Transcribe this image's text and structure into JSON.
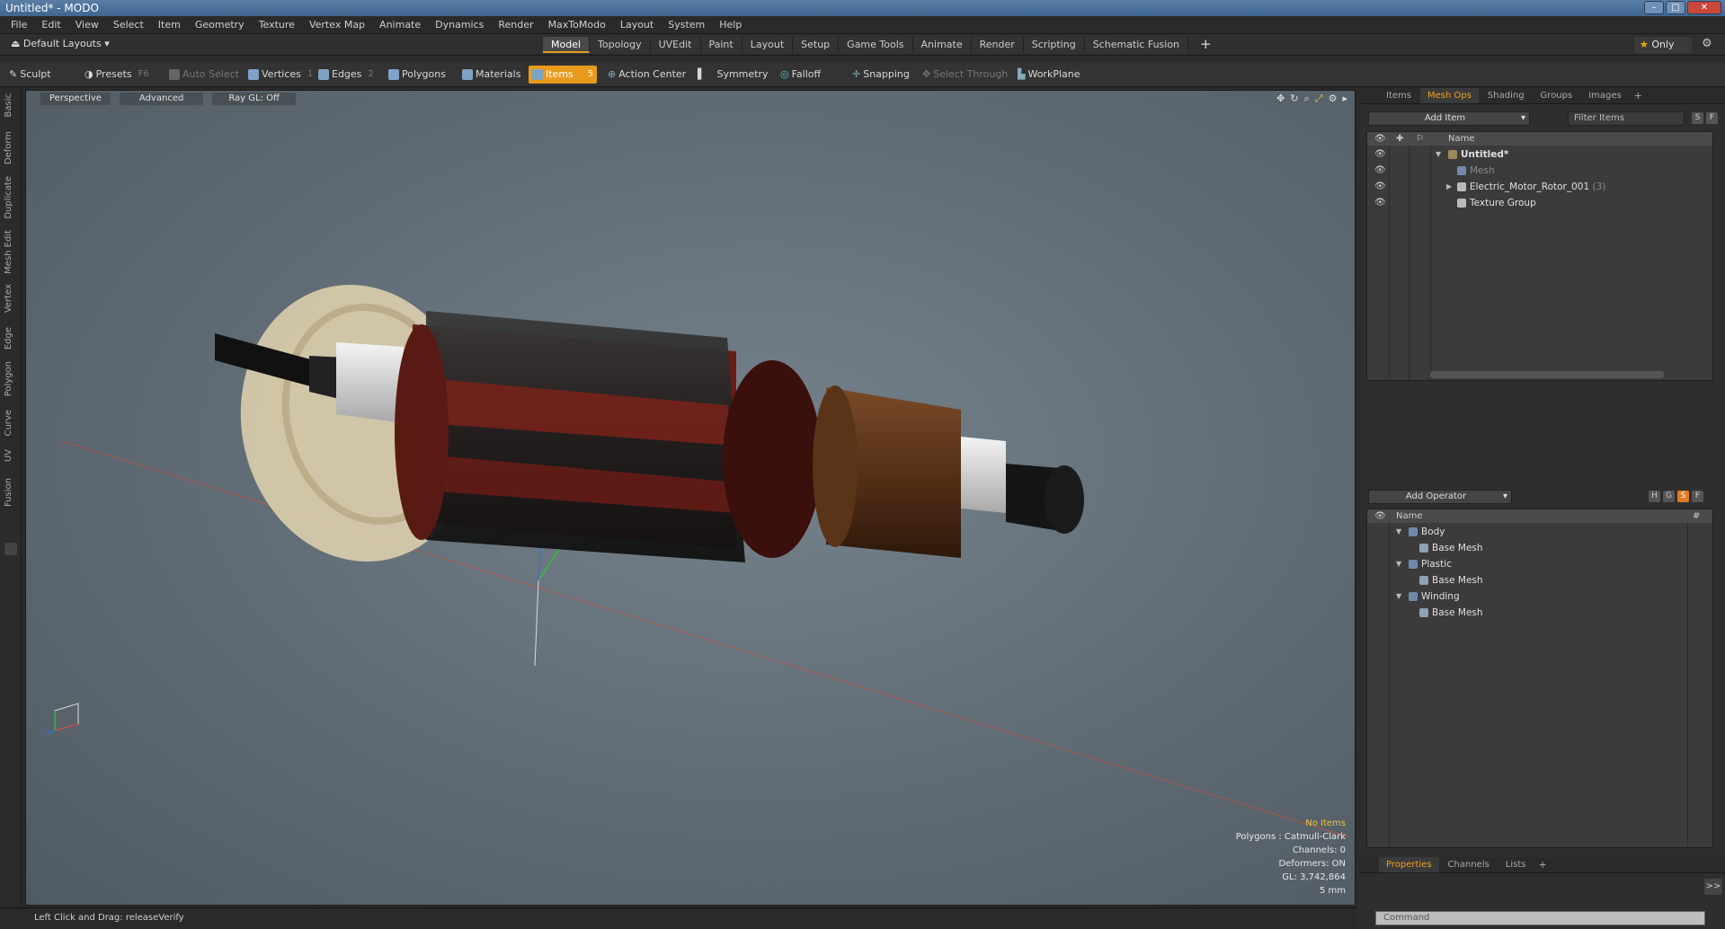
{
  "window": {
    "title": "Untitled* - MODO"
  },
  "menu": [
    "File",
    "Edit",
    "View",
    "Select",
    "Item",
    "Geometry",
    "Texture",
    "Vertex Map",
    "Animate",
    "Dynamics",
    "Render",
    "MaxToModo",
    "Layout",
    "System",
    "Help"
  ],
  "layout_bar": {
    "layout_dropdown": "Default Layouts",
    "tabs": [
      "Model",
      "Topology",
      "UVEdit",
      "Paint",
      "Layout",
      "Setup",
      "Game Tools",
      "Animate",
      "Render",
      "Scripting",
      "Schematic Fusion"
    ],
    "active_tab": "Model",
    "only_label": "Only"
  },
  "toolbar": {
    "sculpt": "Sculpt",
    "presets": "Presets",
    "presets_hotkey": "F6",
    "auto_select": "Auto Select",
    "vertices": "Vertices",
    "vertices_hotkey": "1",
    "edges": "Edges",
    "edges_hotkey": "2",
    "polygons": "Polygons",
    "materials": "Materials",
    "items": "Items",
    "items_hotkey": "5",
    "action_center": "Action Center",
    "symmetry": "Symmetry",
    "falloff": "Falloff",
    "snapping": "Snapping",
    "select_through": "Select Through",
    "workplane": "WorkPlane"
  },
  "left_tabs": [
    "Basic",
    "Deform",
    "Duplicate",
    "Mesh Edit",
    "Vertex",
    "Edge",
    "Polygon",
    "Curve",
    "UV",
    "Fusion"
  ],
  "viewport": {
    "view_mode": "Perspective",
    "shading": "Advanced",
    "raygl": "Ray GL: Off",
    "info": {
      "selection": "No Items",
      "polygons": "Polygons : Catmull-Clark",
      "channels": "Channels: 0",
      "deformers": "Deformers: ON",
      "gl": "GL: 3,742,864",
      "scale": "5 mm"
    }
  },
  "statusbar": {
    "text": "Left Click and Drag:  releaseVerify"
  },
  "items_panel": {
    "tabs": [
      "Items",
      "Mesh Ops",
      "Shading",
      "Groups",
      "Images"
    ],
    "active_tab": "Mesh Ops",
    "add_item": "Add Item",
    "filter": "Filter Items",
    "s_btn": "S",
    "f_btn": "F",
    "col_name": "Name",
    "tree": [
      {
        "label": "Untitled*",
        "depth": 0
      },
      {
        "label": "Mesh",
        "depth": 1
      },
      {
        "label": "Electric_Motor_Rotor_001",
        "count": "(3)",
        "depth": 1
      },
      {
        "label": "Texture Group",
        "depth": 1
      }
    ]
  },
  "meshops_panel": {
    "add_operator": "Add Operator",
    "btn_h": "H",
    "btn_g": "G",
    "btn_s": "S",
    "btn_f": "F",
    "col_name": "Name",
    "col_hash": "#",
    "tree": [
      {
        "label": "Body"
      },
      {
        "label": "Base Mesh"
      },
      {
        "label": "Plastic"
      },
      {
        "label": "Base Mesh"
      },
      {
        "label": "Winding"
      },
      {
        "label": "Base Mesh"
      }
    ]
  },
  "properties_panel": {
    "tabs": [
      "Properties",
      "Channels",
      "Lists"
    ],
    "active_tab": "Properties",
    "expand": ">>",
    "command_placeholder": "Command"
  }
}
